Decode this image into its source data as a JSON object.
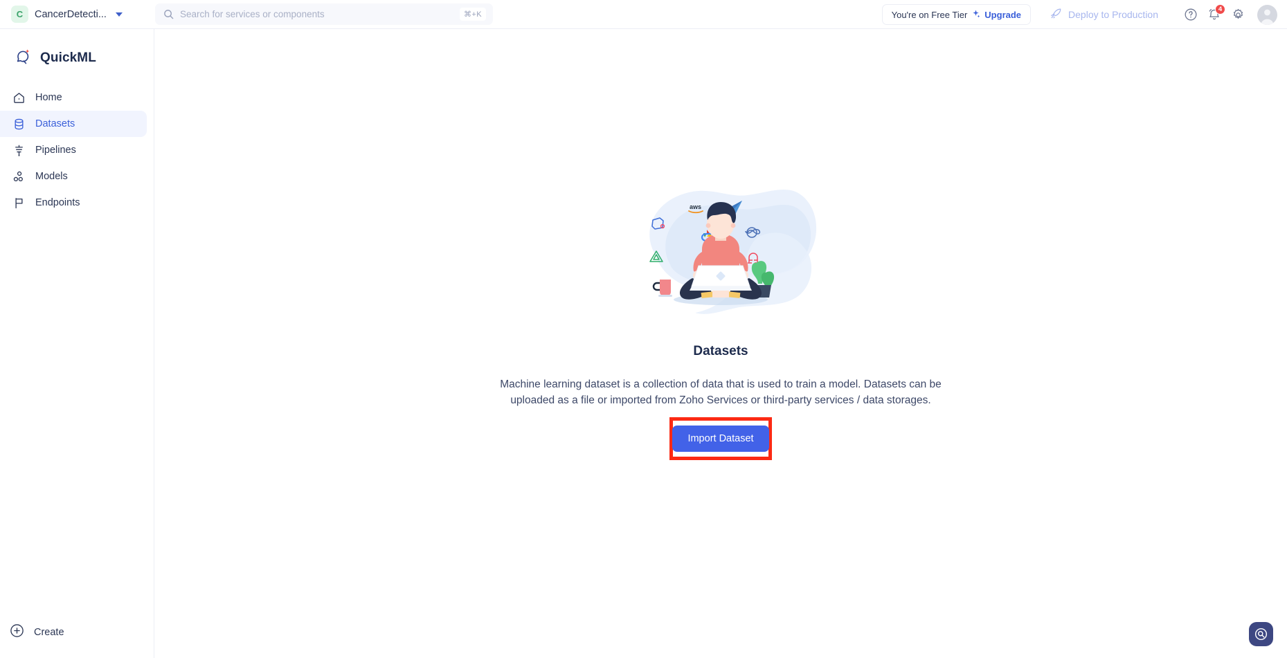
{
  "topbar": {
    "org": {
      "initial": "C",
      "name": "CancerDetecti...",
      "caret_icon": "chevron-down-icon"
    },
    "search": {
      "placeholder": "Search for services or components",
      "value": "",
      "shortcut": "⌘+K",
      "icon": "search-icon"
    },
    "tier": {
      "text": "You're on Free Tier",
      "spark_icon": "sparkle-icon",
      "upgrade": "Upgrade"
    },
    "deploy": {
      "label": "Deploy to Production",
      "icon": "rocket-icon",
      "disabled": true
    },
    "help_icon": "help-circle-icon",
    "notifications": {
      "icon": "bell-icon",
      "count": "4"
    },
    "settings_icon": "gear-icon",
    "avatar_icon": "user-avatar-icon"
  },
  "sidebar": {
    "brand": {
      "name": "QuickML",
      "icon": "quickml-logo-icon"
    },
    "items": [
      {
        "label": "Home",
        "icon": "home-icon",
        "active": false
      },
      {
        "label": "Datasets",
        "icon": "database-icon",
        "active": true
      },
      {
        "label": "Pipelines",
        "icon": "pipeline-funnel-icon",
        "active": false
      },
      {
        "label": "Models",
        "icon": "models-nodes-icon",
        "active": false
      },
      {
        "label": "Endpoints",
        "icon": "flag-icon",
        "active": false
      }
    ],
    "create": {
      "label": "Create",
      "icon": "plus-circle-icon"
    }
  },
  "main": {
    "illustration": {
      "name": "person-with-laptop-cloud-services-illustration",
      "service_icons": [
        "aws-icon",
        "azure-icon",
        "box-icon",
        "google-cloud-icon",
        "infinity-icon",
        "triangle-icon",
        "magnet-icon"
      ]
    },
    "title": "Datasets",
    "description": "Machine learning dataset is a collection of data that is used to train a model. Datasets can be uploaded as a file or imported from Zoho Services or third-party services / data storages.",
    "cta": {
      "label": "Import Dataset",
      "highlighted": true
    }
  },
  "fab": {
    "icon": "search-target-icon"
  },
  "colors": {
    "accent": "#4262e8",
    "accent_text": "#3a5fd9",
    "highlight_box": "#fc2a14",
    "active_nav_bg": "#f1f4fe",
    "badge_red": "#f04a4a",
    "org_avatar_bg": "#e2f6e9",
    "org_avatar_fg": "#3aa36a",
    "fab_bg": "#3d4782",
    "text_dark": "#1d2b4d",
    "text_body": "#3d4868",
    "deploy_disabled": "#a7b6ee"
  }
}
